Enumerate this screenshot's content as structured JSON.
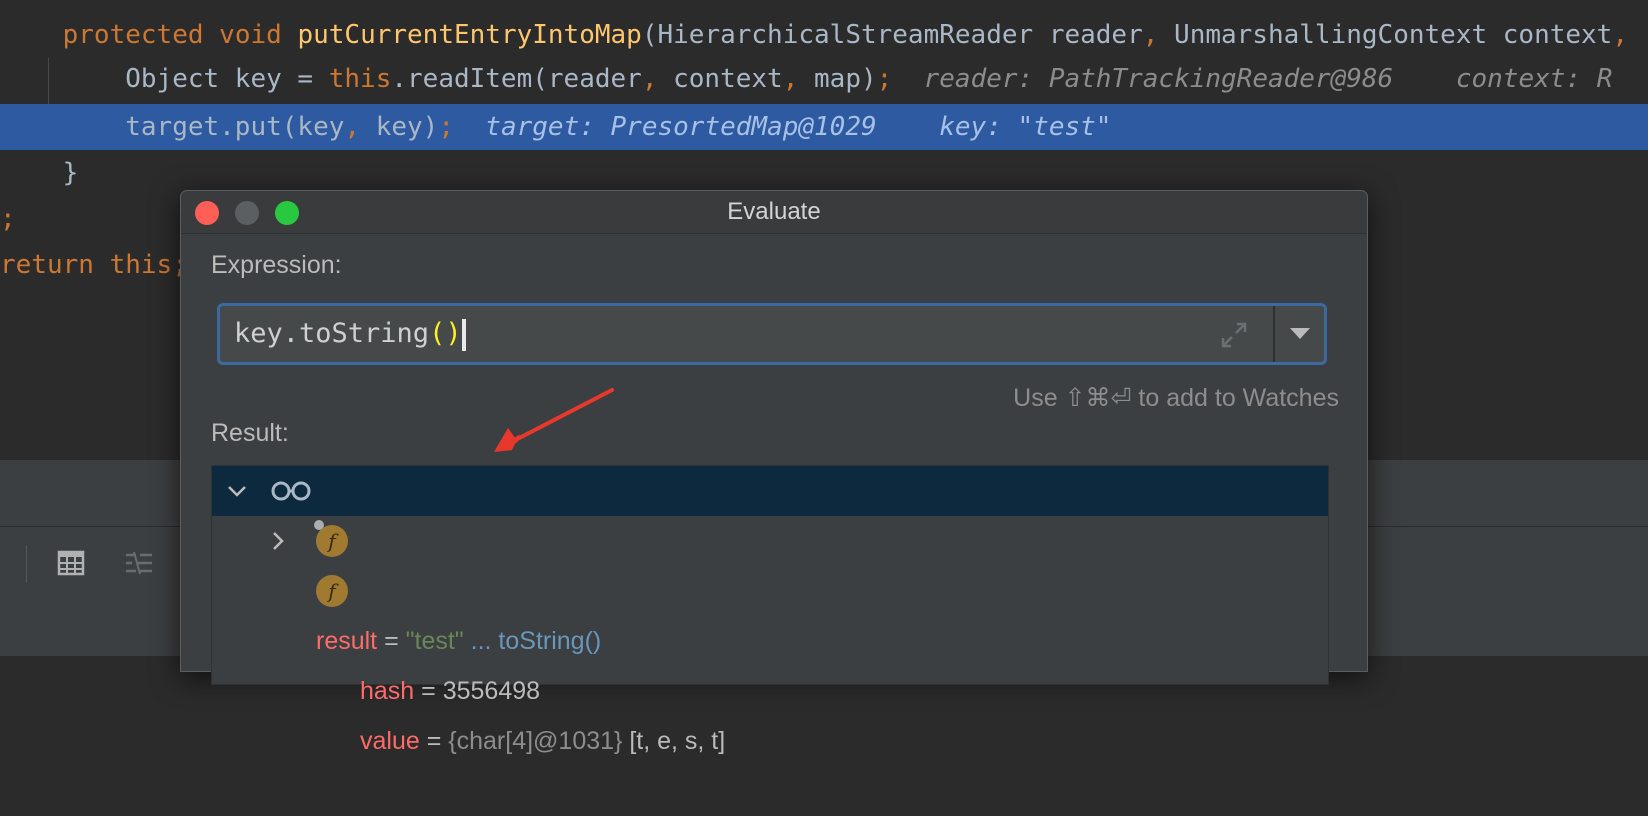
{
  "editor": {
    "lines": [
      {
        "seg": [
          "protected",
          "void",
          "putCurrentEntryIntoMap",
          "(HierarchicalStreamReader reader",
          ",",
          " UnmarshallingContext context",
          ","
        ]
      },
      {
        "seg": [
          "Object key = ",
          "this",
          ".readItem(reader",
          ", ",
          "context",
          ", ",
          "map)",
          ";",
          "reader: PathTrackingReader@986",
          "context: R"
        ]
      },
      {
        "seg": [
          "target.put(key",
          ", ",
          "key)",
          ";",
          "target: PresortedMap@1029",
          "key: \"test\""
        ]
      },
      {
        "seg": [
          "}"
        ]
      },
      {
        "seg": [
          ";"
        ]
      },
      {
        "seg": [
          "return",
          " this",
          ";"
        ]
      }
    ]
  },
  "dialog": {
    "title": "Evaluate",
    "expression_label": "Expression:",
    "expression_value_pre": "key.toString",
    "expression_paren": "()",
    "watch_hint": "Use ⇧⌘⏎ to add to Watches",
    "result_label": "Result:",
    "result_tree": {
      "root": {
        "name": "result",
        "eq": " = ",
        "value": "\"test\"",
        "suffix": " ... toString()"
      },
      "children": [
        {
          "badge": "f",
          "name": "value",
          "eq": " = ",
          "type": "{char[4]@1031}",
          "value": " [t, e, s, t]"
        },
        {
          "badge": "f",
          "name": "hash",
          "eq": " = ",
          "value": "3556498"
        }
      ]
    }
  },
  "colors": {
    "accent_selection": "#2d5aa0",
    "traffic_close": "#ff5f57",
    "traffic_min": "#5c5f61",
    "traffic_max": "#28c940",
    "annotation_arrow": "#e8382b"
  },
  "icons": [
    "expand-icon",
    "dropdown-arrow-icon",
    "chevron-down-icon",
    "chevron-right-icon",
    "watch-glasses-icon",
    "field-badge-icon",
    "table-icon",
    "align-icon"
  ]
}
